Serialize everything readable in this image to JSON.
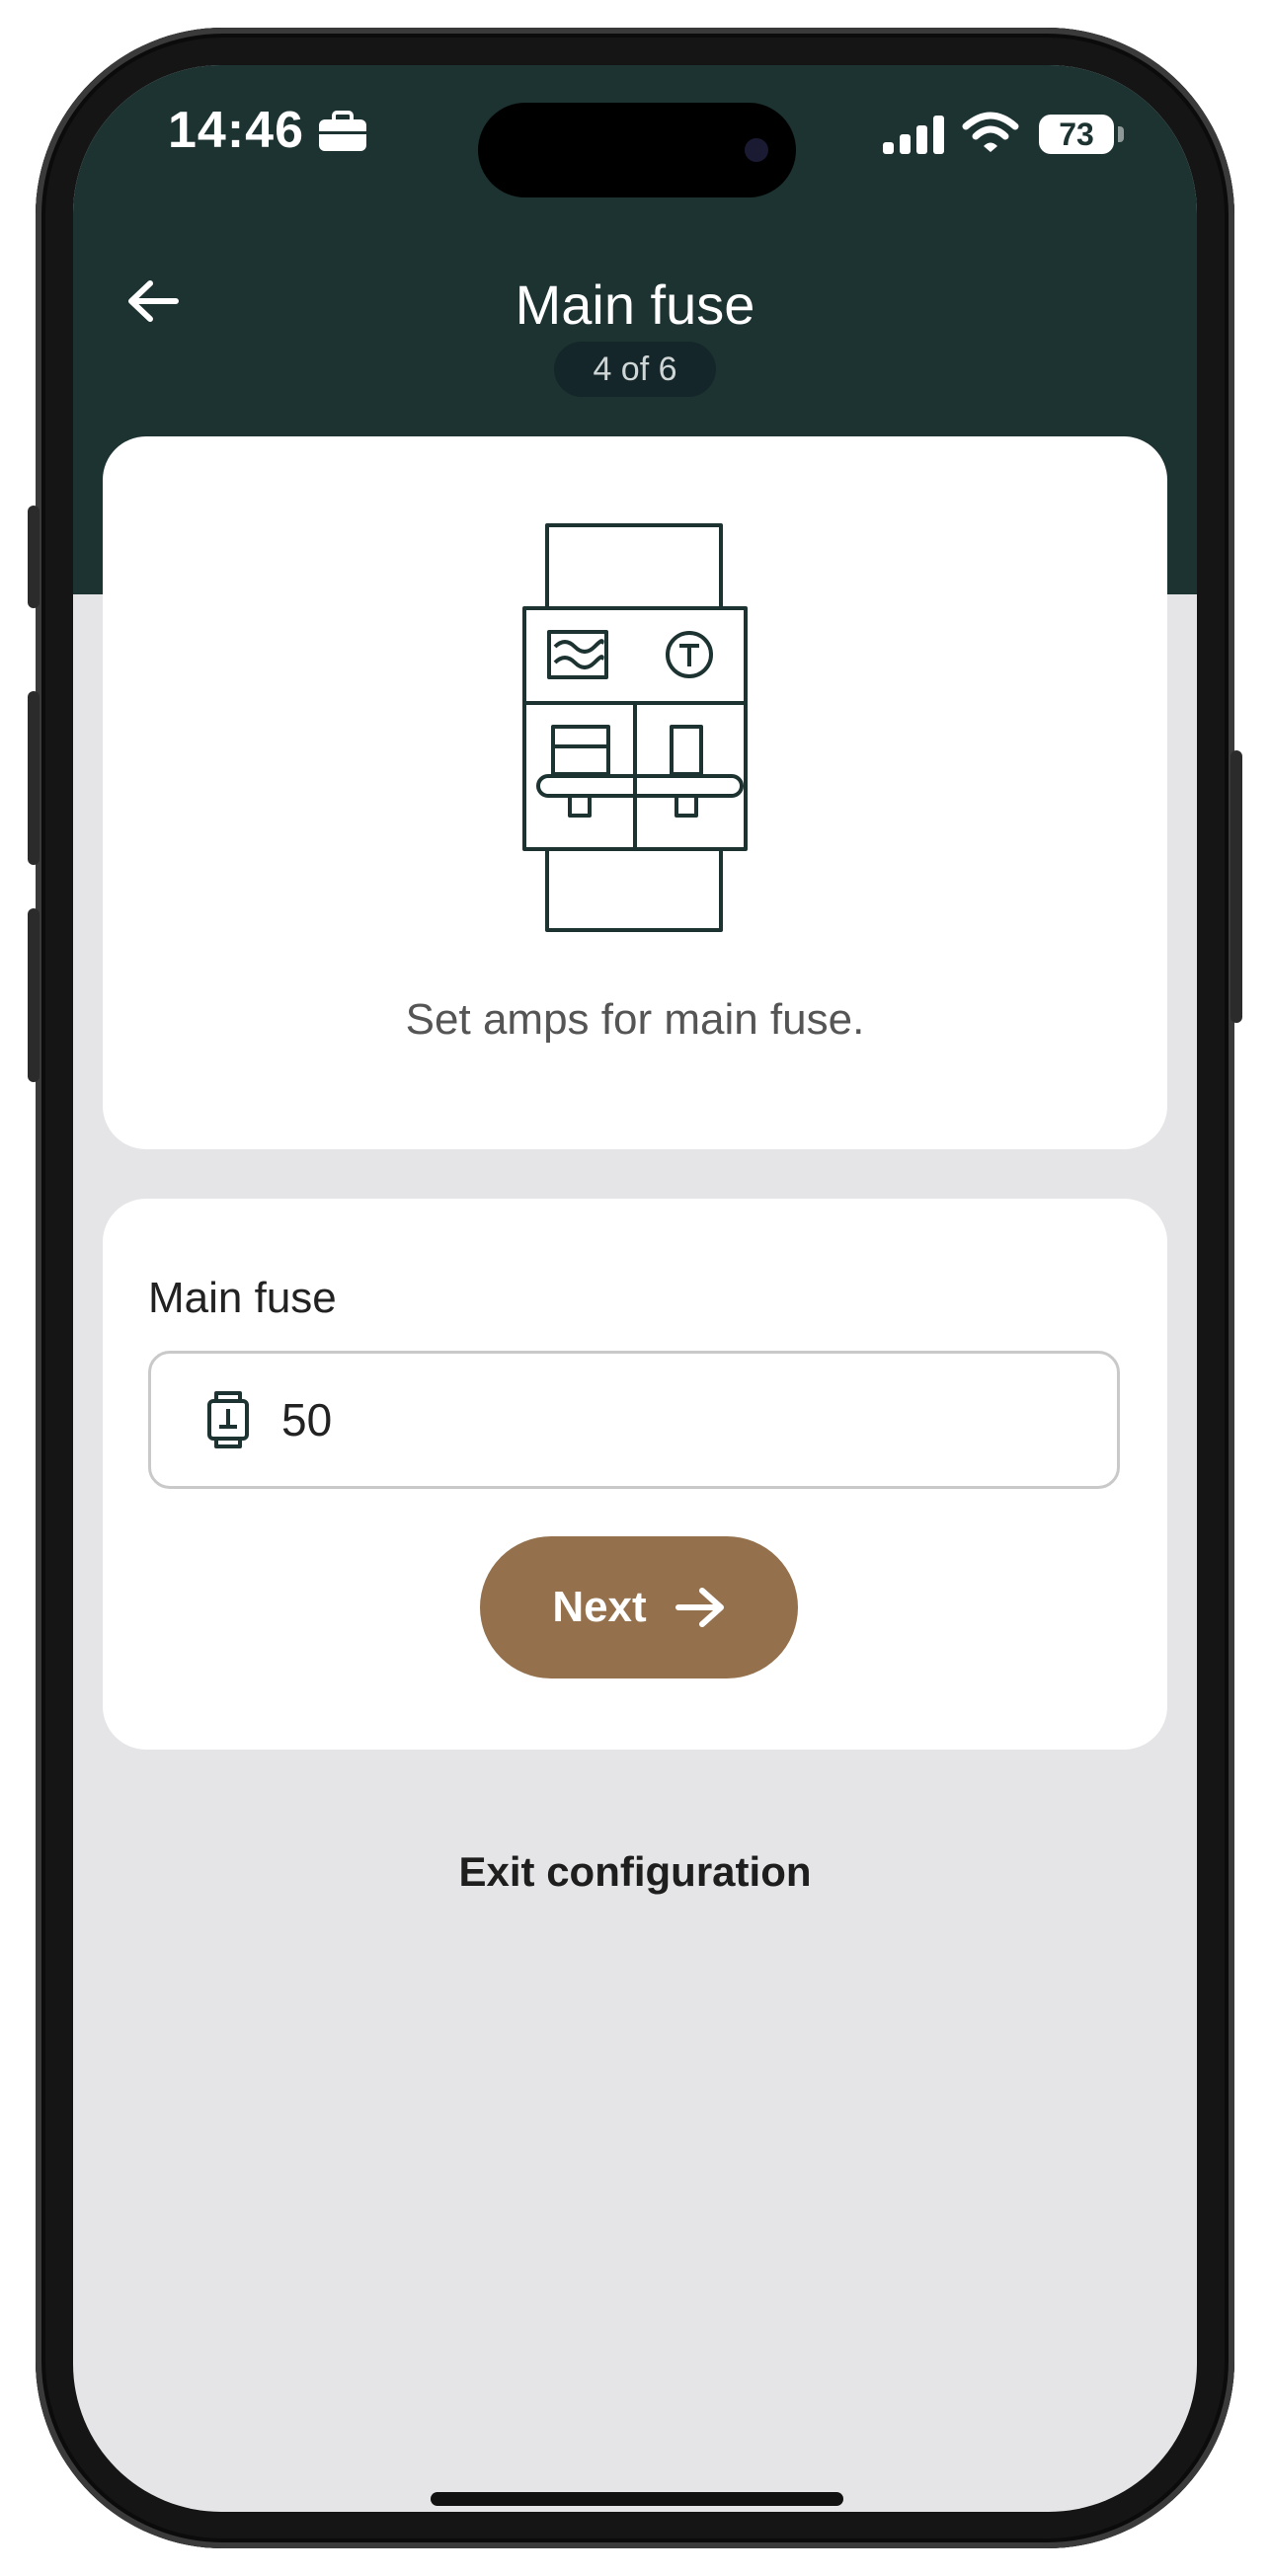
{
  "status_bar": {
    "time": "14:46",
    "battery": "73",
    "icons": [
      "briefcase-icon",
      "cellular-signal-icon",
      "wifi-icon",
      "battery-icon"
    ]
  },
  "header": {
    "title": "Main fuse",
    "step": "4 of 6",
    "back_icon": "arrow-left-icon"
  },
  "illustration_card": {
    "description": "Set amps for main fuse.",
    "icon": "circuit-breaker-illustration"
  },
  "form": {
    "label": "Main fuse",
    "value": "50",
    "input_icon": "fuse-icon",
    "next_label": "Next",
    "next_icon": "arrow-right-icon"
  },
  "exit_label": "Exit configuration",
  "colors": {
    "header": "#1c3331",
    "background": "#e5e5e7",
    "accent": "#94714c",
    "card": "#ffffff"
  }
}
